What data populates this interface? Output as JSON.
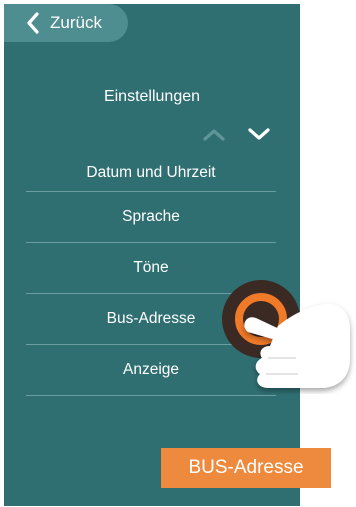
{
  "header": {
    "back_label": "Zurück"
  },
  "page": {
    "title": "Einstellungen"
  },
  "nav": {
    "up_icon": "chevron-up-icon",
    "down_icon": "chevron-down-icon"
  },
  "menu": {
    "items": [
      {
        "label": "Datum und Uhrzeit"
      },
      {
        "label": "Sprache"
      },
      {
        "label": "Töne"
      },
      {
        "label": "Bus-Adresse"
      },
      {
        "label": "Anzeige"
      }
    ]
  },
  "tooltip": {
    "label": "BUS-Adresse"
  },
  "colors": {
    "screen_bg": "#2f6f72",
    "back_button_bg": "#4e8d90",
    "accent_orange": "#ee8a3d"
  }
}
